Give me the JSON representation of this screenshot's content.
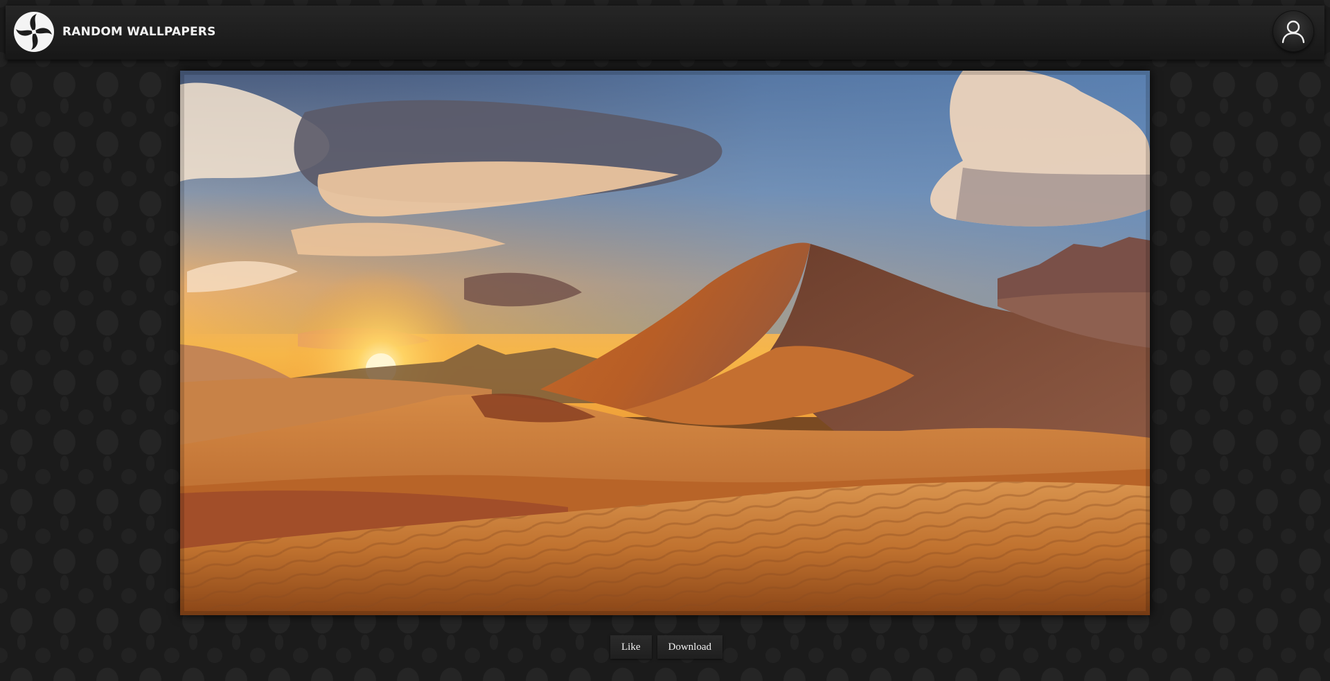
{
  "header": {
    "site_title": "RANDOM WALLPAPERS",
    "logo_icon": "swirl-logo-icon",
    "account_icon": "user-account-icon"
  },
  "wallpaper": {
    "subject": "desert-sand-dunes-at-sunset"
  },
  "actions": {
    "like_label": "Like",
    "download_label": "Download"
  },
  "colors": {
    "header_bg": "#1e1e1e",
    "page_bg": "#1b1b1b",
    "button_bg": "#262626",
    "text": "#f2f2f2"
  }
}
